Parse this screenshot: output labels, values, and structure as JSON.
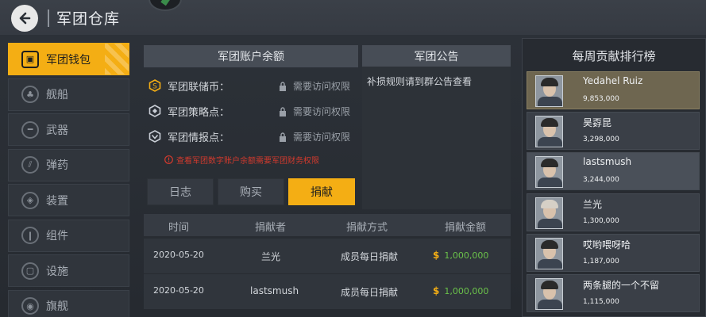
{
  "header": {
    "title": "军团仓库",
    "back_icon": "back-arrow-icon"
  },
  "sidebar": {
    "items": [
      {
        "label": "军团钱包",
        "icon": "wallet-icon",
        "active": true
      },
      {
        "label": "舰船",
        "icon": "ship-icon",
        "active": false
      },
      {
        "label": "武器",
        "icon": "weapon-icon",
        "active": false
      },
      {
        "label": "弹药",
        "icon": "ammo-icon",
        "active": false
      },
      {
        "label": "装置",
        "icon": "device-icon",
        "active": false
      },
      {
        "label": "组件",
        "icon": "component-icon",
        "active": false
      },
      {
        "label": "设施",
        "icon": "facility-icon",
        "active": false
      },
      {
        "label": "旗舰",
        "icon": "flagship-icon",
        "active": false
      }
    ]
  },
  "balance": {
    "title": "军团账户余额",
    "rows": [
      {
        "label": "军团联储币：",
        "permission": "需要访问权限",
        "icon": "reserve-coin-icon"
      },
      {
        "label": "军团策略点：",
        "permission": "需要访问权限",
        "icon": "strategy-point-icon"
      },
      {
        "label": "军团情报点：",
        "permission": "需要访问权限",
        "icon": "intel-point-icon"
      }
    ],
    "warning": "查看军团数字账户余额需要军团财务权限"
  },
  "actions": [
    {
      "label": "日志",
      "active": false
    },
    {
      "label": "购买",
      "active": false
    },
    {
      "label": "捐献",
      "active": true
    }
  ],
  "notice": {
    "title": "军团公告",
    "text": "补损规则请到群公告查看"
  },
  "table": {
    "headers": [
      "时间",
      "捐献者",
      "捐献方式",
      "捐献金额"
    ],
    "rows": [
      {
        "time": "2020-05-20",
        "donor": "兰光",
        "method": "成员每日捐献",
        "currency": "$",
        "amount": "1,000,000"
      },
      {
        "time": "2020-05-20",
        "donor": "lastsmush",
        "method": "成员每日捐献",
        "currency": "$",
        "amount": "1,000,000"
      }
    ]
  },
  "ranking": {
    "title": "每周贡献排行榜",
    "rows": [
      {
        "name": "Yedahel Ruiz",
        "score": "9,853,000",
        "style": "highlight"
      },
      {
        "name": "昊孬昆",
        "score": "3,298,000",
        "style": "normal"
      },
      {
        "name": "lastsmush",
        "score": "3,244,000",
        "style": "light"
      },
      {
        "name": "兰光",
        "score": "1,300,000",
        "style": "normal"
      },
      {
        "name": "哎哟喂呀哈",
        "score": "1,187,000",
        "style": "normal"
      },
      {
        "name": "两条腿的一个不留",
        "score": "1,115,000",
        "style": "normal"
      }
    ]
  },
  "colors": {
    "accent": "#f4ae14",
    "amount": "#6bc24a",
    "warning": "#d23a2d"
  }
}
